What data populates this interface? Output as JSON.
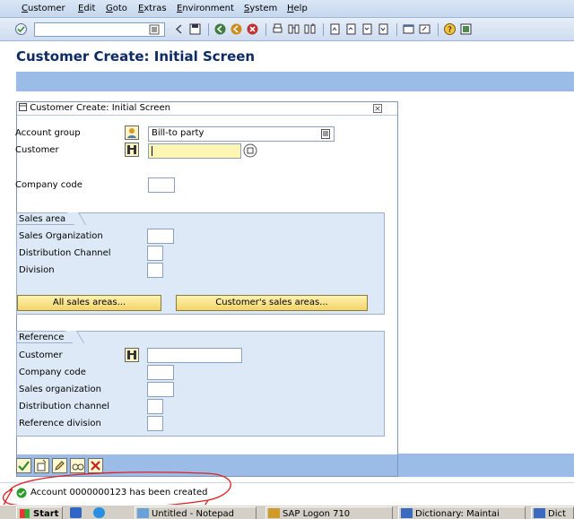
{
  "menu": [
    "Customer",
    "Edit",
    "Goto",
    "Extras",
    "Environment",
    "System",
    "Help"
  ],
  "page_title": "Customer Create: Initial Screen",
  "dialog": {
    "title": "Customer Create: Initial Screen",
    "account_group": {
      "label": "Account group",
      "value": "Bill-to party"
    },
    "customer": {
      "label": "Customer",
      "value": ""
    },
    "company_code": {
      "label": "Company code",
      "value": ""
    },
    "sales_area": {
      "title": "Sales area",
      "fields": [
        "Sales Organization",
        "Distribution Channel",
        "Division"
      ],
      "all_button": "All sales areas...",
      "customer_button": "Customer's sales areas..."
    },
    "reference": {
      "title": "Reference",
      "fields": [
        "Customer",
        "Company code",
        "Sales organization",
        "Distribution channel",
        "Reference division"
      ]
    }
  },
  "status": {
    "message": "Account 0000000123 has been created",
    "color": "#2d9a2d"
  },
  "taskbar": {
    "start": "Start",
    "tasks": [
      "Untitled - Notepad",
      "SAP Logon 710",
      "Dictionary: Maintai",
      "Dict"
    ]
  },
  "colors": {
    "title": "#0b2a66",
    "required_field": "#fff6b3",
    "panel": "#dde9f6",
    "toolbar": "#9cbce8"
  }
}
